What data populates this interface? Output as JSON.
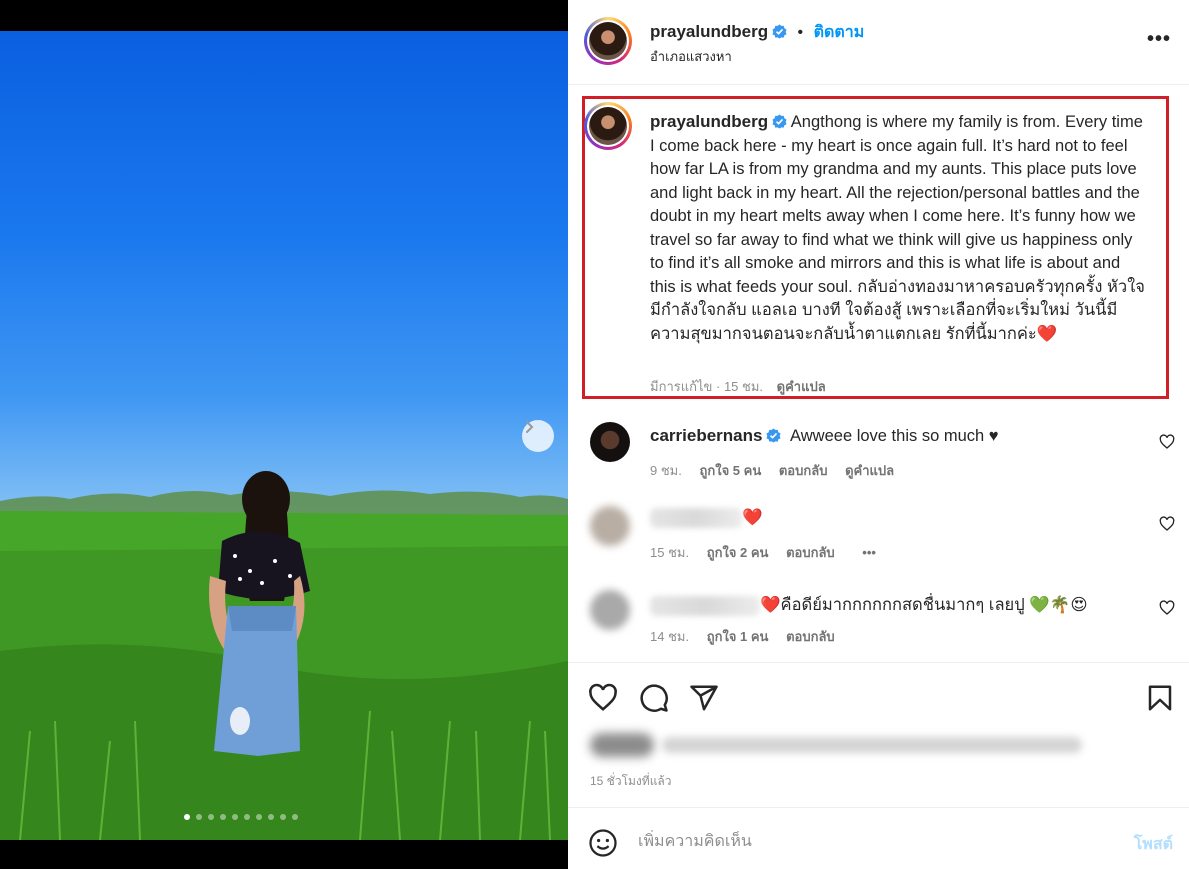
{
  "post": {
    "username": "prayalundberg",
    "follow_label": "ติดตาม",
    "bullet": "•",
    "location": "อำเภอแสวงหา",
    "more_label": "•••",
    "caption": "Angthong is where my family is from. Every time I come back here - my heart is once again full. It’s hard not to feel how far LA is from my grandma and my aunts. This place puts love and light back in my heart. All the rejection/personal battles and the doubt in my heart melts away when I come here. It’s funny how we travel so far away to find what we think will give us happiness only to find it’s all smoke and mirrors and this is what life is about and this is what feeds your soul. กลับอ่างทองมาหาครอบครัวทุกครั้ง หัวใจมีกำลังใจกลับ แอลเอ บางที ใจต้องสู้ เพราะเลือกที่จะเริ่มใหม่ วันนี้มีความสุขมากจนตอนจะกลับน้ำตาแตกเลย รักที่นี้มากค่ะ❤️",
    "caption_edited": "มีการแก้ไข · 15 ชม.",
    "caption_translate": "ดูคำแปล",
    "time_ago": "15 ชั่วโมงที่แล้ว"
  },
  "comments": [
    {
      "username": "carriebernans",
      "text": "Awweee love this so much ♥",
      "time": "9 ชม.",
      "likes": "ถูกใจ 5 คน",
      "reply": "ตอบกลับ",
      "translate": "ดูคำแปล"
    },
    {
      "text": "❤️",
      "time": "15 ชม.",
      "likes": "ถูกใจ 2 คน",
      "reply": "ตอบกลับ",
      "more": "•••"
    },
    {
      "text": "❤️คือดีย์มากกกกกกสดชื่นมากๆ เลยปู 💚🌴😍",
      "time": "14 ชม.",
      "likes": "ถูกใจ 1 คน",
      "reply": "ตอบกลับ"
    }
  ],
  "composer": {
    "placeholder": "เพิ่มความคิดเห็น",
    "post_label": "โพสต์"
  },
  "carousel": {
    "count": 10,
    "active_index": 0
  },
  "colors": {
    "accent": "#0095f6",
    "highlight": "#d01f26",
    "verified": "#3897f0"
  },
  "icons": [
    "chevron-right-icon",
    "verified-badge-icon",
    "more-icon",
    "heart-icon",
    "comment-icon",
    "share-icon",
    "bookmark-icon",
    "emoji-icon"
  ]
}
